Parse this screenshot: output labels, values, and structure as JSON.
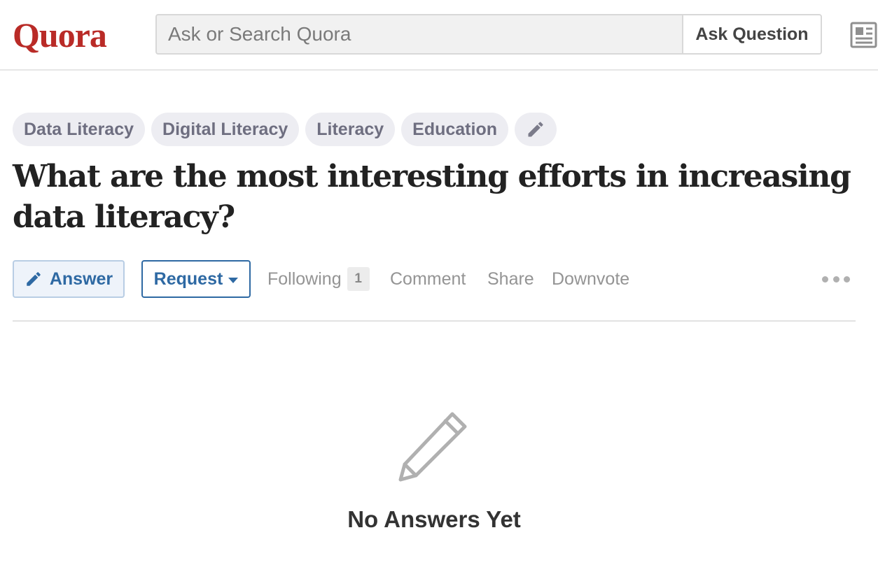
{
  "header": {
    "logo": "Quora",
    "search_placeholder": "Ask or Search Quora",
    "ask_question_label": "Ask Question",
    "news_icon": "news-feed-icon"
  },
  "topics": [
    {
      "label": "Data Literacy"
    },
    {
      "label": "Digital Literacy"
    },
    {
      "label": "Literacy"
    },
    {
      "label": "Education"
    }
  ],
  "topic_edit_icon": "pencil-icon",
  "question": {
    "title": "What are the most interesting efforts in increasing data literacy?"
  },
  "actions": {
    "answer_label": "Answer",
    "request_label": "Request",
    "following_label": "Following",
    "following_count": "1",
    "comment_label": "Comment",
    "share_label": "Share",
    "downvote_label": "Downvote",
    "more_icon": "ellipsis-icon"
  },
  "empty_state": {
    "icon": "pencil-icon",
    "text": "No Answers Yet"
  },
  "colors": {
    "brand": "#b92b27",
    "accent": "#2e69a3",
    "muted_text": "#949494",
    "topic_bg": "#ededf2"
  }
}
